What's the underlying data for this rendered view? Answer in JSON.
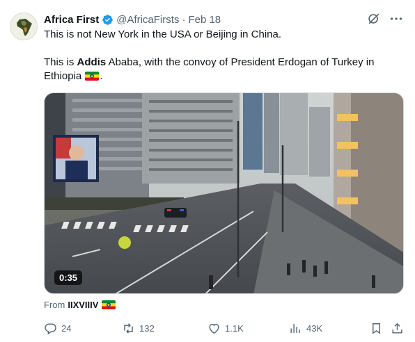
{
  "author": {
    "name": "Africa First",
    "handle": "@AfricaFirsts",
    "separator": "·",
    "date": "Feb 18",
    "verified": true
  },
  "tweet": {
    "line1": "This is not New York in the USA or Beijing in China.",
    "line2_prefix": "This is ",
    "line2_bold": "Addis",
    "line2_rest": " Ababa, with the convoy of President Erdogan of Turkey in",
    "line3_prefix": "Ethiopia",
    "line3_suffix": ".",
    "flag_emoji": "ethiopia-flag"
  },
  "media": {
    "duration": "0:35"
  },
  "source": {
    "prefix": "From",
    "name": "IIXVIIIV",
    "flag_emoji": "ethiopia-flag"
  },
  "actions": {
    "replies": "24",
    "reposts": "132",
    "likes": "1.1K",
    "views": "43K"
  },
  "colors": {
    "text": "#0f1419",
    "secondary": "#536471",
    "verified": "#1d9bf0",
    "border": "#cfd9de"
  }
}
